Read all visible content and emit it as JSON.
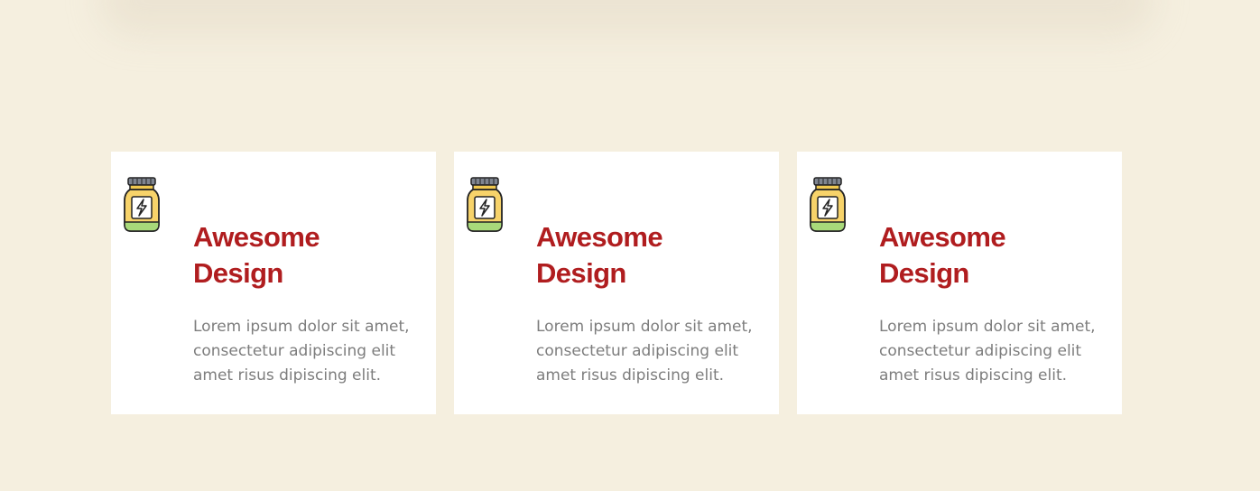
{
  "features": {
    "cards": [
      {
        "icon": "energy-jar-icon",
        "title": "Awesome Design",
        "text": "Lorem ipsum dolor sit amet, consectetur adipiscing elit amet risus dipiscing elit."
      },
      {
        "icon": "energy-jar-icon",
        "title": "Awesome Design",
        "text": "Lorem ipsum dolor sit amet, consectetur adipiscing elit amet risus dipiscing elit."
      },
      {
        "icon": "energy-jar-icon",
        "title": "Awesome Design",
        "text": "Lorem ipsum dolor sit amet, consectetur adipiscing elit amet risus dipiscing elit."
      }
    ]
  },
  "colors": {
    "background": "#f5efdf",
    "card": "#ffffff",
    "title": "#b01d1f",
    "body_text": "#7d7d7d",
    "icon_fill": "#f7d36a",
    "icon_base": "#a8d97a",
    "icon_cap": "#7f8590"
  }
}
